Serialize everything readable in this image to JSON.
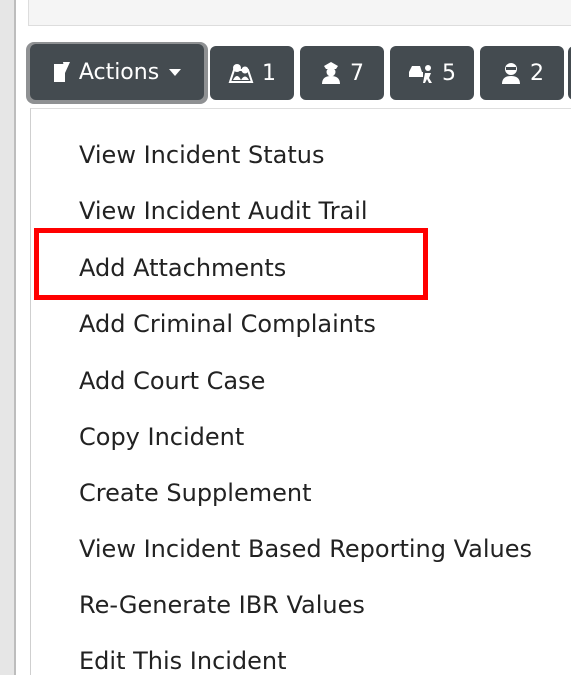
{
  "toolbar": {
    "actions_label": "Actions",
    "counters": [
      {
        "icon": "map-pin-people-icon",
        "count": "1"
      },
      {
        "icon": "officer-icon",
        "count": "7"
      },
      {
        "icon": "vehicle-person-icon",
        "count": "5"
      },
      {
        "icon": "suspect-icon",
        "count": "2"
      }
    ]
  },
  "menu": {
    "items": [
      "View Incident Status",
      "View Incident Audit Trail",
      "Add Attachments",
      "Add Criminal Complaints",
      "Add Court Case",
      "Copy Incident",
      "Create Supplement",
      "View Incident Based Reporting Values",
      "Re-Generate IBR Values",
      "Edit This Incident"
    ],
    "highlighted": "Add Attachments"
  },
  "colors": {
    "button_bg": "#444b50",
    "highlight": "#ff0000"
  }
}
